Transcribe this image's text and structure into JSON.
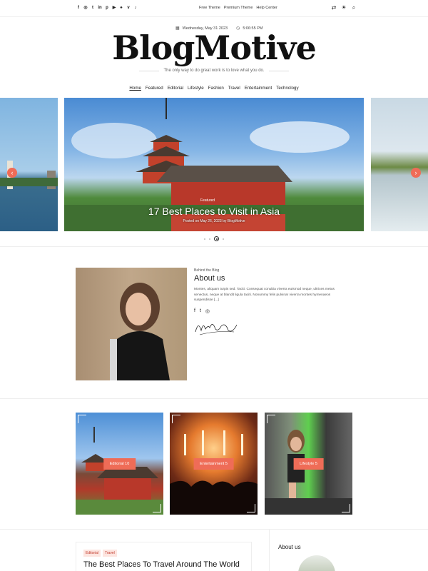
{
  "topbar": {
    "social_icons": [
      "facebook-icon",
      "instagram-icon",
      "twitter-icon",
      "linkedin-icon",
      "pinterest-icon",
      "youtube-icon",
      "snapchat-icon",
      "vk-icon",
      "tiktok-icon"
    ],
    "links": [
      "Free Theme",
      "Premium Theme",
      "Help Center"
    ],
    "tools": [
      "shuffle-icon",
      "theme-toggle-icon",
      "search-icon"
    ]
  },
  "header": {
    "date": "Wednesday, May 31 2023",
    "time": "5:06:55 PM",
    "logo": "BlogMotive",
    "tagline": "The only way to do great work is to love what you do."
  },
  "nav": [
    "Home",
    "Featured",
    "Editorial",
    "Lifestyle",
    "Fashion",
    "Travel",
    "Entertainment",
    "Technology"
  ],
  "slider": {
    "badge": "Featured",
    "title": "17 Best Places to Visit in Asia",
    "meta": "Posted on May 26, 2023 by BlogMotive",
    "prev_icon": "‹",
    "next_icon": "›"
  },
  "about": {
    "kicker": "Behind the Blog",
    "title": "About us",
    "text": "Montes, aliquam turpis sed. Taciti. Consequat conubia viverra euismod neque, ultrices metus senectus, neque at blandit ligula taciti. Nonummy felis pulvinar viverra montes hymenaeos suspendisse [...]",
    "social": [
      "f",
      "t",
      "◎"
    ]
  },
  "categories": [
    {
      "label": "Editorial 10"
    },
    {
      "label": "Entertainment 5"
    },
    {
      "label": "Lifestyle 5"
    }
  ],
  "post": {
    "tags": [
      "Editorial",
      "Travel"
    ],
    "title": "The Best Places To Travel Around The World In 2023: Chosen By The Experts"
  },
  "sidebar": {
    "widget_title": "About us"
  },
  "colors": {
    "accent": "#ef6c57"
  }
}
